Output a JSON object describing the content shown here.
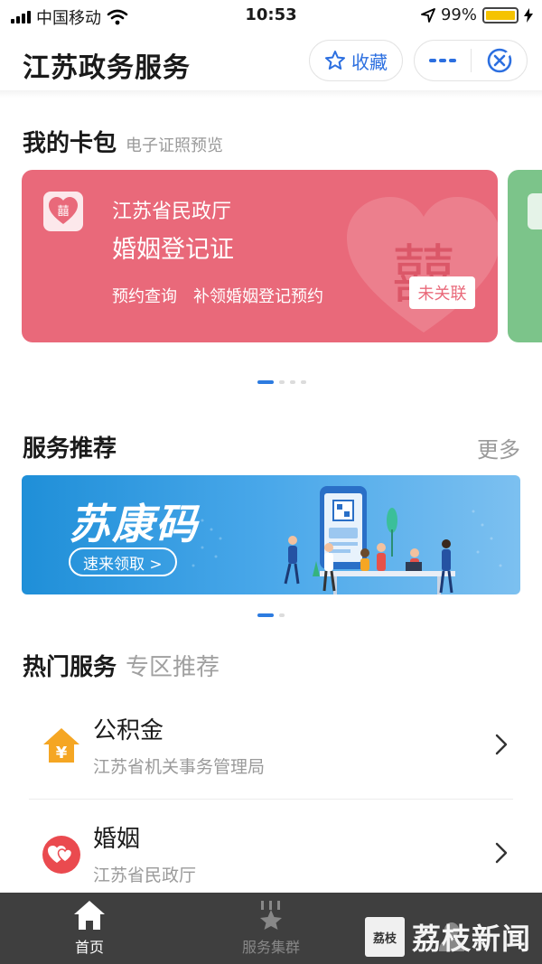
{
  "status_bar": {
    "carrier": "中国移动",
    "time": "10:53",
    "battery": "99%",
    "battery_level": 0.99
  },
  "header": {
    "title": "江苏政务服务",
    "favorite_label": "收藏"
  },
  "wallet": {
    "title": "我的卡包",
    "subtitle": "电子证照预览",
    "card": {
      "org": "江苏省民政厅",
      "name": "婚姻登记证",
      "links": [
        "预约查询",
        "补领婚姻登记预约"
      ],
      "badge": "未关联",
      "color": "#e9697a"
    },
    "next_card_color": "#7cc48a"
  },
  "recommend": {
    "title": "服务推荐",
    "more": "更多",
    "banner": {
      "title": "苏康码",
      "button": "速来领取 >"
    }
  },
  "hot": {
    "title": "热门服务",
    "subtitle": "专区推荐",
    "items": [
      {
        "title": "公积金",
        "sub": "江苏省机关事务管理局",
        "icon": "house-yuan-icon"
      },
      {
        "title": "婚姻",
        "sub": "江苏省民政厅",
        "icon": "hearts-icon"
      }
    ]
  },
  "tabbar": {
    "tabs": [
      {
        "label": "首页",
        "active": true
      },
      {
        "label": "服务集群",
        "active": false
      }
    ]
  },
  "watermark": {
    "logo_text": "荔枝",
    "text": "荔枝新闻"
  }
}
